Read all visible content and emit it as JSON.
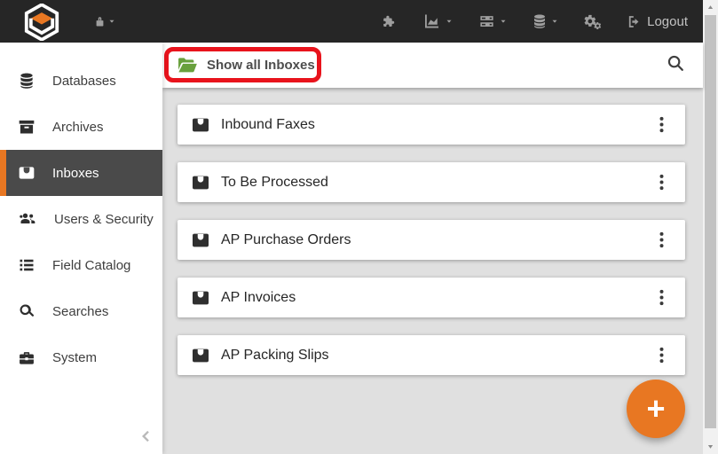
{
  "topbar": {
    "logo_name": "square9-cube-logo",
    "logout_label": "Logout",
    "icon_names": [
      "lock-icon",
      "puzzle-piece-icon",
      "area-chart-icon",
      "server-list-icon",
      "database-icon",
      "gears-icon",
      "sign-out-icon"
    ]
  },
  "sidebar": {
    "items": [
      {
        "label": "Databases",
        "icon": "database-icon",
        "selected": false
      },
      {
        "label": "Archives",
        "icon": "archive-box-icon",
        "selected": false
      },
      {
        "label": "Inboxes",
        "icon": "inbox-icon",
        "selected": true
      },
      {
        "label": "Users & Security",
        "icon": "users-group-icon",
        "selected": false
      },
      {
        "label": "Field Catalog",
        "icon": "list-icon",
        "selected": false
      },
      {
        "label": "Searches",
        "icon": "magnifier-icon",
        "selected": false
      },
      {
        "label": "System",
        "icon": "briefcase-icon",
        "selected": false
      }
    ],
    "collapse_icon": "chevron-left-icon"
  },
  "header": {
    "show_all_label": "Show all Inboxes",
    "show_all_icon": "open-folder-icon",
    "search_icon": "search-icon",
    "annotation": "red-highlight-rectangle"
  },
  "inboxes": [
    {
      "name": "Inbound Faxes"
    },
    {
      "name": "To Be Processed"
    },
    {
      "name": "AP Purchase Orders"
    },
    {
      "name": "AP Invoices"
    },
    {
      "name": "AP Packing Slips"
    }
  ],
  "fab": {
    "label": "+",
    "icon": "plus-icon"
  },
  "colors": {
    "topbar_bg": "#262626",
    "accent_orange": "#e87722",
    "selected_row_bg": "#4a4a4a",
    "content_bg": "#e0e0e0",
    "annotation_red": "#e8131c",
    "folder_green": "#68a03c"
  }
}
